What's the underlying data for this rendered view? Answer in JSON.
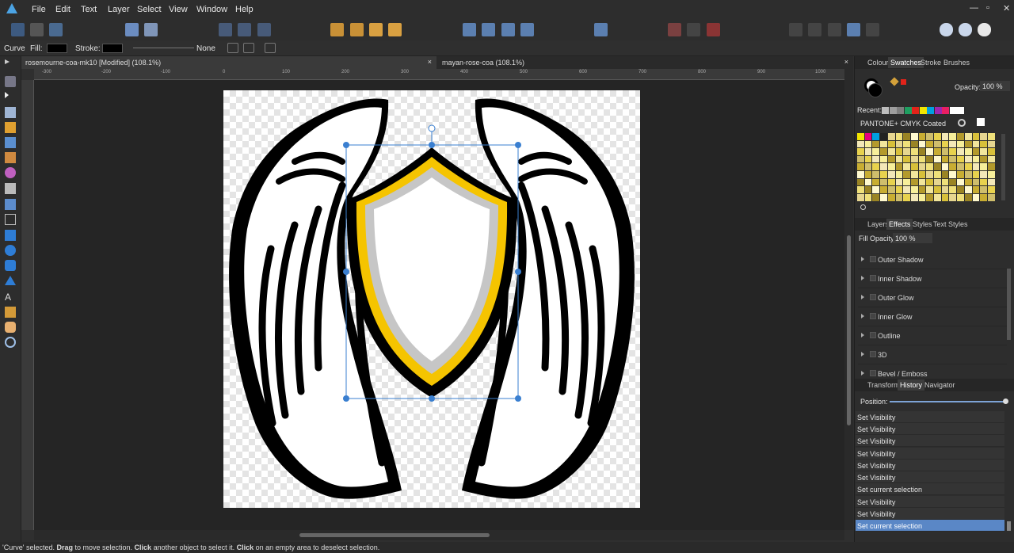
{
  "menu": [
    "File",
    "Edit",
    "Text",
    "Layer",
    "Select",
    "View",
    "Window",
    "Help"
  ],
  "window_controls": {
    "minimize": "—",
    "restore": "▫",
    "close": "✕"
  },
  "context": {
    "tool": "Curve",
    "fill_label": "Fill:",
    "stroke_label": "Stroke:",
    "stroke_style": "None"
  },
  "tabs": [
    {
      "label": "rosemourne-coa-mk10 [Modified] (108.1%)",
      "close": "×",
      "active": true
    },
    {
      "label": "mayan-rose-coa (108.1%)",
      "close": "×",
      "active": false
    }
  ],
  "ruler_labels": [
    "-300",
    "-200",
    "-100",
    "0",
    "100",
    "200",
    "300",
    "400",
    "500",
    "600",
    "700",
    "800",
    "900",
    "1000"
  ],
  "right_panel": {
    "top_tabs": [
      "Colour",
      "Swatches",
      "Stroke",
      "Brushes"
    ],
    "opacity_label": "Opacity:",
    "opacity_value": "100 %",
    "recent_label": "Recent:",
    "recent_colors": [
      "#bdbdbd",
      "#9e9e9e",
      "#7e7e7e",
      "#1e9e60",
      "#e2231a",
      "#f2e500",
      "#00a0e0",
      "#9c27b0",
      "#e91e63",
      "#ffffff",
      "#ffffff"
    ],
    "palette_name": "PANTONE+ CMYK Coated",
    "effects_tabs": [
      "Layers",
      "Effects",
      "Styles",
      "Text Styles"
    ],
    "fill_opacity_label": "Fill Opacity:",
    "fill_opacity_value": "100 %",
    "effects": [
      "Outer Shadow",
      "Inner Shadow",
      "Outer Glow",
      "Inner Glow",
      "Outline",
      "3D",
      "Bevel / Emboss"
    ],
    "history_tabs": [
      "Transform",
      "History",
      "Navigator"
    ],
    "position_label": "Position:",
    "history": [
      "Set Visibility",
      "Set Visibility",
      "Set Visibility",
      "Set Visibility",
      "Set Visibility",
      "Set Visibility",
      "Set current selection",
      "Set Visibility",
      "Set Visibility",
      "Set current selection"
    ]
  },
  "status": {
    "quote_open": "'Curve'",
    "t1": " selected. ",
    "drag": "Drag",
    "t2": " to move selection. ",
    "click1": "Click",
    "t3": " another object to select it. ",
    "click2": "Click",
    "t4": " on an empty area to deselect selection."
  },
  "colors": {
    "accent": "#5a87c6",
    "selection": "#3a7fd0",
    "shield_gold": "#f5c400",
    "canvas_bg": "#252525"
  }
}
